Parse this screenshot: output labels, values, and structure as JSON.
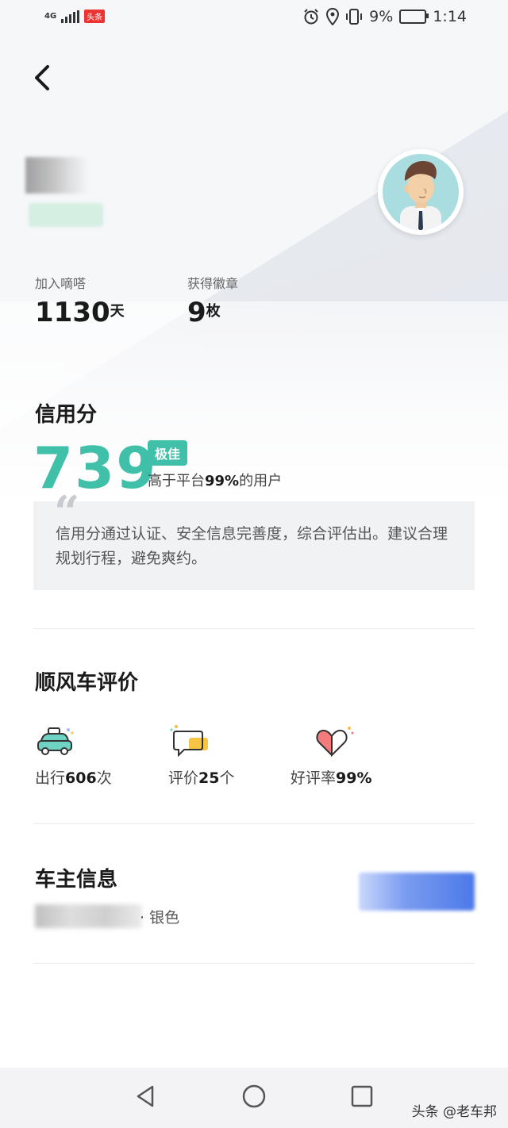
{
  "status_bar": {
    "network": "4G",
    "app_badge": "头条",
    "battery_percent": "9%",
    "time": "1:14"
  },
  "profile": {
    "join_label": "加入嘀嗒",
    "join_value": "1130",
    "join_unit": "天",
    "badge_label": "获得徽章",
    "badge_value": "9",
    "badge_unit": "枚"
  },
  "credit": {
    "title": "信用分",
    "score": "739",
    "level": "极佳",
    "desc_prefix": "高于平台",
    "desc_percent": "99%",
    "desc_suffix": "的用户",
    "note": "信用分通过认证、安全信息完善度，综合评估出。建议合理规划行程，避免爽约。"
  },
  "ride_eval": {
    "title": "顺风车评价",
    "items": [
      {
        "prefix": "出行",
        "value": "606",
        "suffix": "次",
        "icon": "car-icon"
      },
      {
        "prefix": "评价",
        "value": "25",
        "suffix": "个",
        "icon": "chat-bubble-icon"
      },
      {
        "prefix": "好评率",
        "value": "99%",
        "suffix": "",
        "icon": "heart-icon"
      }
    ]
  },
  "owner": {
    "title": "车主信息",
    "car_color": "· 银色"
  },
  "watermark": "头条 @老车邦",
  "colors": {
    "accent": "#40c0a8",
    "plate": "#4c79e9"
  }
}
